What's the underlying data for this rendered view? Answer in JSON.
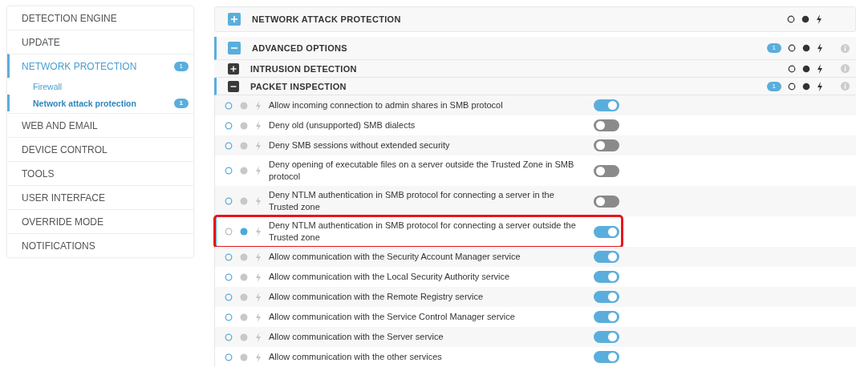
{
  "sidebar": {
    "items": [
      {
        "label": "DETECTION ENGINE",
        "selected": false
      },
      {
        "label": "UPDATE",
        "selected": false
      },
      {
        "label": "NETWORK PROTECTION",
        "selected": true,
        "badge": "1",
        "children": [
          {
            "label": "Firewall",
            "selected": false
          },
          {
            "label": "Network attack protection",
            "selected": true,
            "badge": "1"
          }
        ]
      },
      {
        "label": "WEB AND EMAIL",
        "selected": false
      },
      {
        "label": "DEVICE CONTROL",
        "selected": false
      },
      {
        "label": "TOOLS",
        "selected": false
      },
      {
        "label": "USER INTERFACE",
        "selected": false
      },
      {
        "label": "OVERRIDE MODE",
        "selected": false
      },
      {
        "label": "NOTIFICATIONS",
        "selected": false
      }
    ]
  },
  "sections": [
    {
      "kind": "top",
      "title": "NETWORK ATTACK PROTECTION",
      "expanded": false,
      "modified": false,
      "info": false
    },
    {
      "kind": "group",
      "title": "ADVANCED OPTIONS",
      "expanded": true,
      "modified": true,
      "badge": "1",
      "info": true
    },
    {
      "kind": "subgroup",
      "title": "INTRUSION DETECTION",
      "expanded": false,
      "modified": false,
      "info": true
    },
    {
      "kind": "subgroup",
      "title": "PACKET INSPECTION",
      "expanded": true,
      "modified": true,
      "badge": "1",
      "info": true
    }
  ],
  "settings": [
    {
      "label": "Allow incoming connection to admin shares in SMB protocol",
      "on": true,
      "changed": false,
      "highlighted": false
    },
    {
      "label": "Deny old (unsupported) SMB dialects",
      "on": false,
      "changed": false,
      "highlighted": false
    },
    {
      "label": "Deny SMB sessions without extended security",
      "on": false,
      "changed": false,
      "highlighted": false
    },
    {
      "label": "Deny opening of executable files on a server outside the Trusted Zone in SMB protocol",
      "on": false,
      "changed": false,
      "highlighted": false
    },
    {
      "label": "Deny NTLM authentication in SMB protocol for connecting a server in the Trusted zone",
      "on": false,
      "changed": false,
      "highlighted": false
    },
    {
      "label": "Deny NTLM authentication in SMB protocol for connecting a server outside the Trusted zone",
      "on": true,
      "changed": true,
      "highlighted": true
    },
    {
      "label": "Allow communication with the Security Account Manager service",
      "on": true,
      "changed": false,
      "highlighted": false
    },
    {
      "label": "Allow communication with the Local Security Authority service",
      "on": true,
      "changed": false,
      "highlighted": false
    },
    {
      "label": "Allow communication with the Remote Registry service",
      "on": true,
      "changed": false,
      "highlighted": false
    },
    {
      "label": "Allow communication with the Service Control Manager service",
      "on": true,
      "changed": false,
      "highlighted": false
    },
    {
      "label": "Allow communication with the Server service",
      "on": true,
      "changed": false,
      "highlighted": false
    },
    {
      "label": "Allow communication with the other services",
      "on": true,
      "changed": false,
      "highlighted": false
    }
  ]
}
